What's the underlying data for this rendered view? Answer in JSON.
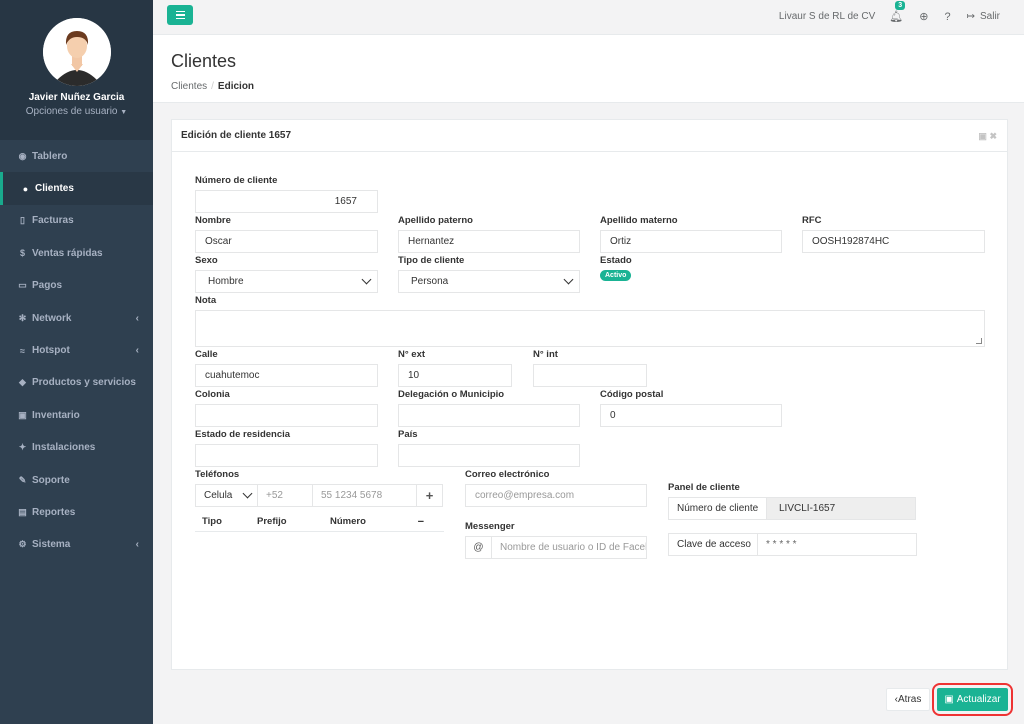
{
  "user": {
    "name": "Javier Nuñez Garcia",
    "options": "Opciones de usuario"
  },
  "sidebar": {
    "items": [
      {
        "label": "Tablero",
        "icon": "dashboard-icon"
      },
      {
        "label": "Clientes",
        "icon": "users-icon",
        "active": true
      },
      {
        "label": "Facturas",
        "icon": "file-icon"
      },
      {
        "label": "Ventas rápidas",
        "icon": "dollar-icon"
      },
      {
        "label": "Pagos",
        "icon": "money-icon"
      },
      {
        "label": "Network",
        "icon": "network-icon",
        "submenu": true
      },
      {
        "label": "Hotspot",
        "icon": "wifi-icon",
        "submenu": true
      },
      {
        "label": "Productos y servicios",
        "icon": "tags-icon"
      },
      {
        "label": "Inventario",
        "icon": "cubes-icon"
      },
      {
        "label": "Instalaciones",
        "icon": "wrench-icon"
      },
      {
        "label": "Soporte",
        "icon": "tool-icon"
      },
      {
        "label": "Reportes",
        "icon": "book-icon"
      },
      {
        "label": "Sistema",
        "icon": "cogs-icon",
        "submenu": true
      }
    ]
  },
  "topbar": {
    "company": "Livaur S de RL de CV",
    "notifications": "3",
    "logout": "Salir"
  },
  "page": {
    "title": "Clientes",
    "breadcrumb_1": "Clientes",
    "breadcrumb_2": "Edicion"
  },
  "card": {
    "title": "Edición de cliente 1657"
  },
  "form": {
    "numero_label": "Número de cliente",
    "numero_value": "1657",
    "nombre_label": "Nombre",
    "nombre_value": "Oscar",
    "paterno_label": "Apellido paterno",
    "paterno_value": "Hernantez",
    "materno_label": "Apellido materno",
    "materno_value": "Ortiz",
    "rfc_label": "RFC",
    "rfc_value": "OOSH192874HC",
    "sexo_label": "Sexo",
    "sexo_value": "Hombre",
    "tipo_label": "Tipo de cliente",
    "tipo_value": "Persona",
    "estado_label": "Estado",
    "estado_value": "Activo",
    "nota_label": "Nota",
    "calle_label": "Calle",
    "calle_value": "cuahutemoc",
    "next_label": "N° ext",
    "next_value": "10",
    "nint_label": "N° int",
    "colonia_label": "Colonia",
    "delegacion_label": "Delegación o Municipio",
    "cp_label": "Código postal",
    "cp_value": "0",
    "residencia_label": "Estado de residencia",
    "pais_label": "País",
    "telefonos_label": "Teléfonos",
    "tel_tipo_value": "Celula",
    "tel_prefijo_placeholder": "+52",
    "tel_numero_placeholder": "55 1234 5678",
    "tel_add": "+",
    "col_tipo": "Tipo",
    "col_prefijo": "Prefijo",
    "col_numero": "Número",
    "col_remove": "−",
    "correo_label": "Correo electrónico",
    "correo_placeholder": "correo@empresa.com",
    "messenger_label": "Messenger",
    "messenger_prefix": "@",
    "messenger_placeholder": "Nombre de usuario o ID de Facebook",
    "panel_label": "Panel de cliente",
    "panel_num_label": "Número de cliente",
    "panel_num_value": "LIVCLI-1657",
    "panel_clave_label": "Clave de acceso",
    "panel_clave_value": "* * * * *"
  },
  "buttons": {
    "back": "Atras",
    "update": "Actualizar"
  }
}
